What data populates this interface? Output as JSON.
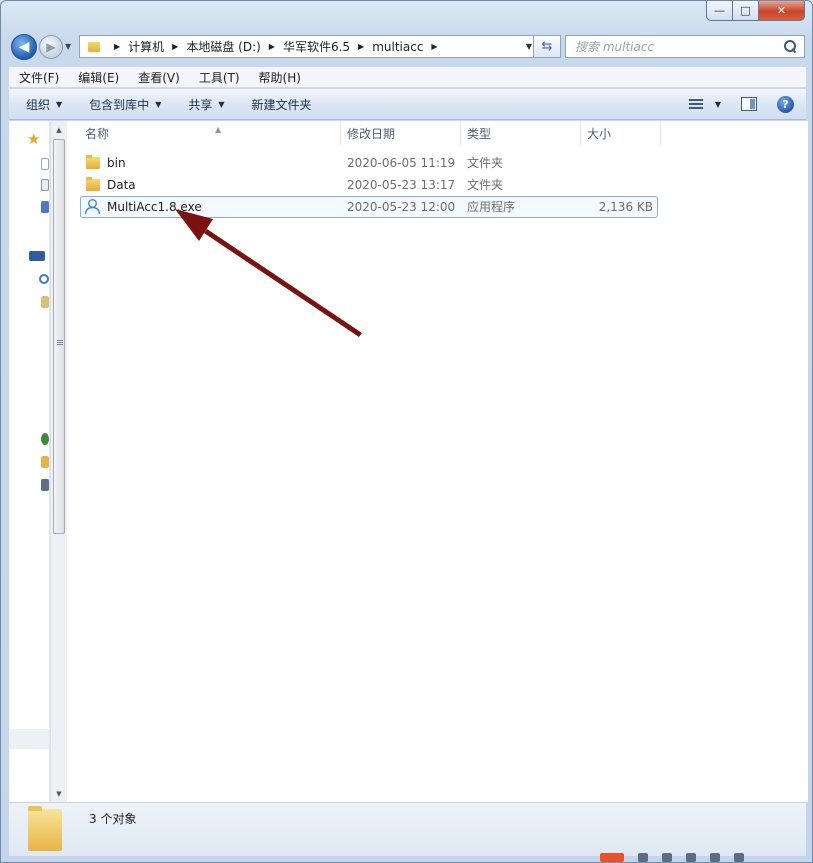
{
  "window": {
    "caption": {
      "minimize": "—",
      "maximize": "□",
      "close": "✕"
    }
  },
  "nav": {
    "back_glyph": "◀",
    "forward_glyph": "▶",
    "breadcrumbs": [
      "计算机",
      "本地磁盘 (D:)",
      "华军软件6.5",
      "multiacc"
    ],
    "refresh_glyph": "⇆",
    "search_placeholder": "搜索 multiacc"
  },
  "menubar": [
    "文件(F)",
    "编辑(E)",
    "查看(V)",
    "工具(T)",
    "帮助(H)"
  ],
  "toolbar": {
    "organize": "组织",
    "include_in_library": "包含到库中",
    "share": "共享",
    "new_folder": "新建文件夹",
    "help": "?"
  },
  "columns": {
    "name": "名称",
    "date": "修改日期",
    "type": "类型",
    "size": "大小"
  },
  "files": [
    {
      "name": "bin",
      "date": "2020-06-05 11:19",
      "type": "文件夹",
      "size": "",
      "icon": "folder-icon"
    },
    {
      "name": "Data",
      "date": "2020-05-23 13:17",
      "type": "文件夹",
      "size": "",
      "icon": "folder-icon"
    },
    {
      "name": "MultiAcc1.8.exe",
      "date": "2020-05-23 12:00",
      "type": "应用程序",
      "size": "2,136 KB",
      "icon": "application-icon",
      "selected": true
    }
  ],
  "annotation": {
    "type": "arrow",
    "color": "#7a1212",
    "points_to": "MultiAcc1.8.exe"
  },
  "status": {
    "text": "3 个对象"
  }
}
